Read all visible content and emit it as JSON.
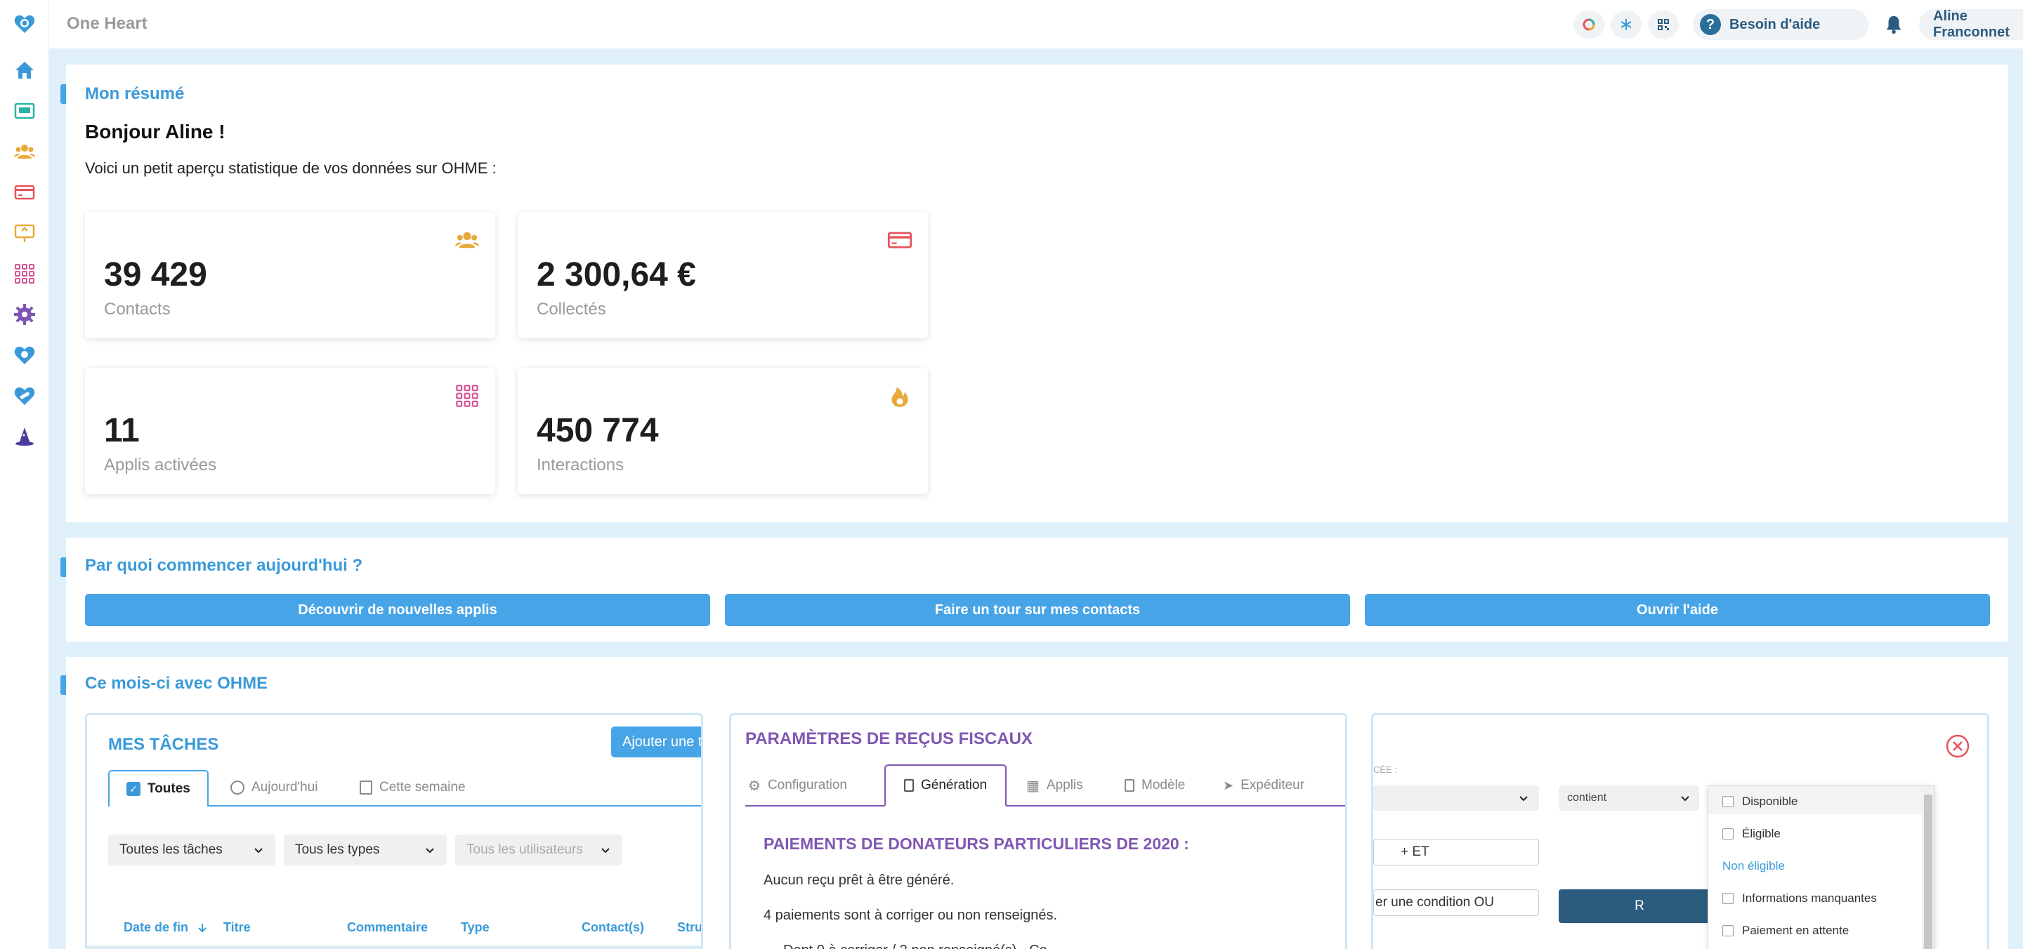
{
  "app": {
    "title": "One Heart"
  },
  "topbar": {
    "help_label": "Besoin d'aide",
    "user_label": "Aline Franconnet"
  },
  "summary": {
    "section_title": "Mon résumé",
    "greeting": "Bonjour Aline !",
    "intro": "Voici un petit aperçu statistique de vos données sur OHME :",
    "stats": [
      {
        "value": "39 429",
        "label": "Contacts",
        "icon": "contacts-icon"
      },
      {
        "value": "2 300,64 €",
        "label": "Collectés",
        "icon": "credit-card-icon"
      },
      {
        "value": "11",
        "label": "Applis activées",
        "icon": "apps-grid-icon"
      },
      {
        "value": "450 774",
        "label": "Interactions",
        "icon": "flame-icon"
      }
    ]
  },
  "start": {
    "section_title": "Par quoi commencer aujourd'hui ?",
    "buttons": [
      "Découvrir de nouvelles applis",
      "Faire un tour sur mes contacts",
      "Ouvrir l'aide"
    ]
  },
  "month": {
    "section_title": "Ce mois-ci avec OHME",
    "tasks": {
      "title": "MES TÂCHES",
      "add_button": "Ajouter une t",
      "tabs": [
        "Toutes",
        "Aujourd'hui",
        "Cette semaine"
      ],
      "filters": [
        "Toutes les tâches",
        "Tous les types",
        "Tous les utilisateurs"
      ],
      "columns": [
        "Date de fin",
        "Titre",
        "Commentaire",
        "Type",
        "Contact(s)",
        "Stru"
      ]
    },
    "receipts": {
      "title": "PARAMÈTRES DE REÇUS FISCAUX",
      "tabs": [
        "Configuration",
        "Génération",
        "Applis",
        "Modèle",
        "Expéditeur"
      ],
      "subtitle": "PAIEMENTS DE DONATEURS PARTICULIERS DE 2020 :",
      "line1": "Aucun reçu prêt à être généré.",
      "line2": "4 paiements sont à corriger ou non renseignés.",
      "line3": "Dont 0 à corriger / 2 non renseigné(s) - Co"
    },
    "filter_panel": {
      "label": "CÉE :",
      "operator": "contient",
      "and_button": "+ ET",
      "or_button": "er une condition OU",
      "submit_button": "R",
      "options": [
        {
          "label": "Disponible",
          "checked": false
        },
        {
          "label": "Éligible",
          "checked": false
        },
        {
          "label": "Non éligible",
          "link": true
        },
        {
          "label": "Informations manquantes",
          "checked": false
        },
        {
          "label": "Paiement en attente",
          "checked": false
        }
      ]
    }
  },
  "colors": {
    "accent": "#47a4e6",
    "title_blue": "#3a9ad9",
    "purple": "#8057b2",
    "dark_blue": "#2b5b7e"
  }
}
